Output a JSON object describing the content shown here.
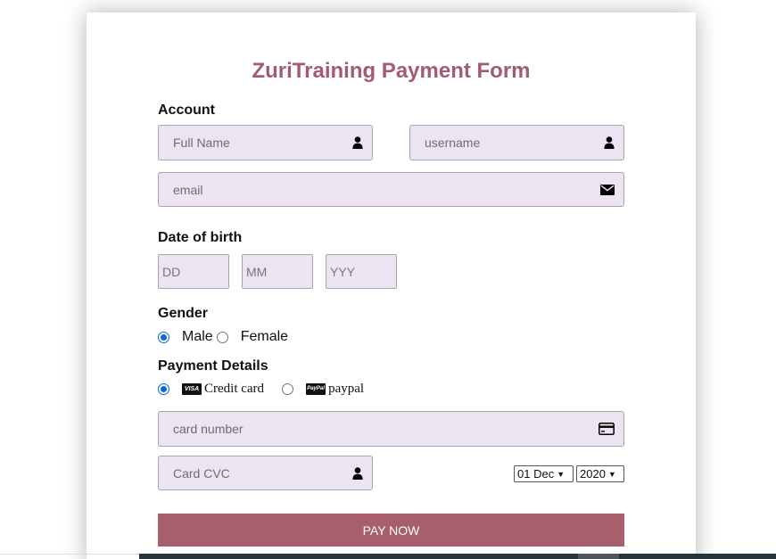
{
  "form": {
    "title": "ZuriTraining Payment Form",
    "account_label": "Account",
    "full_name_placeholder": "Full Name",
    "username_placeholder": "username",
    "email_placeholder": "email",
    "dob_label": "Date of birth",
    "dd_placeholder": "DD",
    "mm_placeholder": "MM",
    "yyy_placeholder": "YYY",
    "gender_label": "Gender",
    "gender_options": [
      "Male",
      "Female"
    ],
    "gender_selected": "Male",
    "payment_label": "Payment Details",
    "payment_options": [
      "Credit card",
      "paypal"
    ],
    "payment_selected": "Credit card",
    "visa_badge": "VISA",
    "paypal_badge": "PayPal",
    "card_number_placeholder": "card number",
    "cvc_placeholder": "Card CVC",
    "expiry_day_month": "01 Dec",
    "expiry_year": "2020",
    "pay_button": "PAY NOW"
  },
  "colors": {
    "title": "#a15d6c",
    "field_bg": "#ece4f1",
    "button_bg": "#a75f6d",
    "radio_checked": "#0b68d8"
  },
  "icons": {
    "full_name": "user-icon",
    "username": "user-icon",
    "email": "envelope-icon",
    "card_number": "credit-card-icon",
    "cvc": "user-icon"
  }
}
